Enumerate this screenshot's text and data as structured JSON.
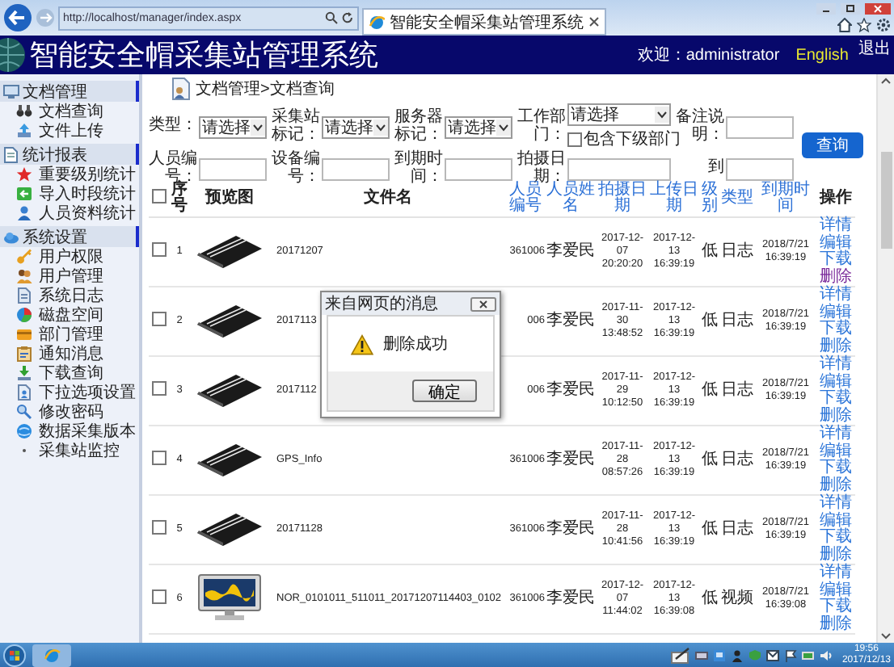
{
  "browser": {
    "url": "http://localhost/manager/index.aspx",
    "tab_title": "智能安全帽采集站管理系统"
  },
  "header": {
    "title": "智能安全帽采集站管理系统",
    "welcome": "欢迎：administrator",
    "language": "English",
    "logout": "退出"
  },
  "sidebar": {
    "sections": [
      {
        "title": "文档管理",
        "items": [
          {
            "label": "文档查询"
          },
          {
            "label": "文件上传"
          }
        ]
      },
      {
        "title": "统计报表",
        "items": [
          {
            "label": "重要级别统计"
          },
          {
            "label": "导入时段统计"
          },
          {
            "label": "人员资料统计"
          }
        ]
      },
      {
        "title": "系统设置",
        "items": [
          {
            "label": "用户权限"
          },
          {
            "label": "用户管理"
          },
          {
            "label": "系统日志"
          },
          {
            "label": "磁盘空间"
          },
          {
            "label": "部门管理"
          },
          {
            "label": "通知消息"
          },
          {
            "label": "下载查询"
          },
          {
            "label": "下拉选项设置"
          },
          {
            "label": "修改密码"
          },
          {
            "label": "数据采集版本"
          },
          {
            "label": "采集站监控"
          }
        ]
      }
    ]
  },
  "breadcrumb": "文档管理>文档查询",
  "filters": [
    {
      "kind": "select",
      "label": "类型：",
      "value": "请选择"
    },
    {
      "kind": "select",
      "label": "采集站标记：",
      "value": "请选择"
    },
    {
      "kind": "select",
      "label": "服务器标记：",
      "value": "请选择"
    },
    {
      "kind": "select",
      "label": "工作部门：",
      "value": "请选择",
      "option": {
        "label": "包含下级部门",
        "checked": false
      }
    },
    {
      "kind": "input",
      "label": "备注说明："
    },
    {
      "kind": "input",
      "label": "人员编号："
    },
    {
      "kind": "input",
      "label": "设备编号："
    },
    {
      "kind": "input",
      "label": "到期时间："
    },
    {
      "kind": "input",
      "label": "拍摄日期："
    },
    {
      "kind": "input",
      "label": "到"
    }
  ],
  "query_button": "查询",
  "table": {
    "header_checked": false,
    "columns": [
      {
        "label": "序号",
        "sortable": false
      },
      {
        "label": "预览图",
        "sortable": false
      },
      {
        "label": "文件名",
        "sortable": false
      },
      {
        "label": "人员编号",
        "sortable": true
      },
      {
        "label": "人员姓名",
        "sortable": true
      },
      {
        "label": "拍摄日期",
        "sortable": true
      },
      {
        "label": "上传日期",
        "sortable": true
      },
      {
        "label": "级别",
        "sortable": true
      },
      {
        "label": "类型",
        "sortable": true
      },
      {
        "label": "到期时间",
        "sortable": true
      },
      {
        "label": "操作",
        "sortable": false
      }
    ],
    "rows": [
      {
        "checked": false,
        "number": "1",
        "kind": "log",
        "filename": "20171207",
        "person_id": "361006",
        "person_name": "李爱民",
        "shot_date": "2017-12-07 20:20:20",
        "upload_date": "2017-12-13 16:39:19",
        "level": "低",
        "type": "日志",
        "expiry": "2018/7/21 16:39:19",
        "actions": [
          {
            "label": "详情",
            "visited": false
          },
          {
            "label": "编辑",
            "visited": false
          },
          {
            "label": "下载",
            "visited": false
          },
          {
            "label": "删除",
            "visited": true
          }
        ]
      },
      {
        "checked": false,
        "number": "2",
        "kind": "log",
        "filename": "2017113",
        "person_id": "006",
        "person_name": "李爱民",
        "shot_date": "2017-11-30 13:48:52",
        "upload_date": "2017-12-13 16:39:19",
        "level": "低",
        "type": "日志",
        "expiry": "2018/7/21 16:39:19",
        "actions": [
          {
            "label": "详情",
            "visited": false
          },
          {
            "label": "编辑",
            "visited": false
          },
          {
            "label": "下载",
            "visited": false
          },
          {
            "label": "删除",
            "visited": false
          }
        ]
      },
      {
        "checked": false,
        "number": "3",
        "kind": "log",
        "filename": "2017112",
        "person_id": "006",
        "person_name": "李爱民",
        "shot_date": "2017-11-29 10:12:50",
        "upload_date": "2017-12-13 16:39:19",
        "level": "低",
        "type": "日志",
        "expiry": "2018/7/21 16:39:19",
        "actions": [
          {
            "label": "详情",
            "visited": false
          },
          {
            "label": "编辑",
            "visited": false
          },
          {
            "label": "下载",
            "visited": false
          },
          {
            "label": "删除",
            "visited": false
          }
        ]
      },
      {
        "checked": false,
        "number": "4",
        "kind": "log",
        "filename": "GPS_Info",
        "person_id": "361006",
        "person_name": "李爱民",
        "shot_date": "2017-11-28 08:57:26",
        "upload_date": "2017-12-13 16:39:19",
        "level": "低",
        "type": "日志",
        "expiry": "2018/7/21 16:39:19",
        "actions": [
          {
            "label": "详情",
            "visited": false
          },
          {
            "label": "编辑",
            "visited": false
          },
          {
            "label": "下载",
            "visited": false
          },
          {
            "label": "删除",
            "visited": false
          }
        ]
      },
      {
        "checked": false,
        "number": "5",
        "kind": "log",
        "filename": "20171128",
        "person_id": "361006",
        "person_name": "李爱民",
        "shot_date": "2017-11-28 10:41:56",
        "upload_date": "2017-12-13 16:39:19",
        "level": "低",
        "type": "日志",
        "expiry": "2018/7/21 16:39:19",
        "actions": [
          {
            "label": "详情",
            "visited": false
          },
          {
            "label": "编辑",
            "visited": false
          },
          {
            "label": "下载",
            "visited": false
          },
          {
            "label": "删除",
            "visited": false
          }
        ]
      },
      {
        "checked": false,
        "number": "6",
        "kind": "video",
        "filename": "NOR_0101011_511011_20171207114403_0102",
        "person_id": "361006",
        "person_name": "李爱民",
        "shot_date": "2017-12-07 11:44:02",
        "upload_date": "2017-12-13 16:39:08",
        "level": "低",
        "type": "视频",
        "expiry": "2018/7/21 16:39:08",
        "actions": [
          {
            "label": "详情",
            "visited": false
          },
          {
            "label": "编辑",
            "visited": false
          },
          {
            "label": "下载",
            "visited": false
          },
          {
            "label": "删除",
            "visited": false
          }
        ]
      }
    ]
  },
  "dialog": {
    "title": "来自网页的消息",
    "message": "删除成功",
    "button": "确定"
  },
  "taskbar": {
    "time": "19:56",
    "date": "2017/12/13"
  }
}
